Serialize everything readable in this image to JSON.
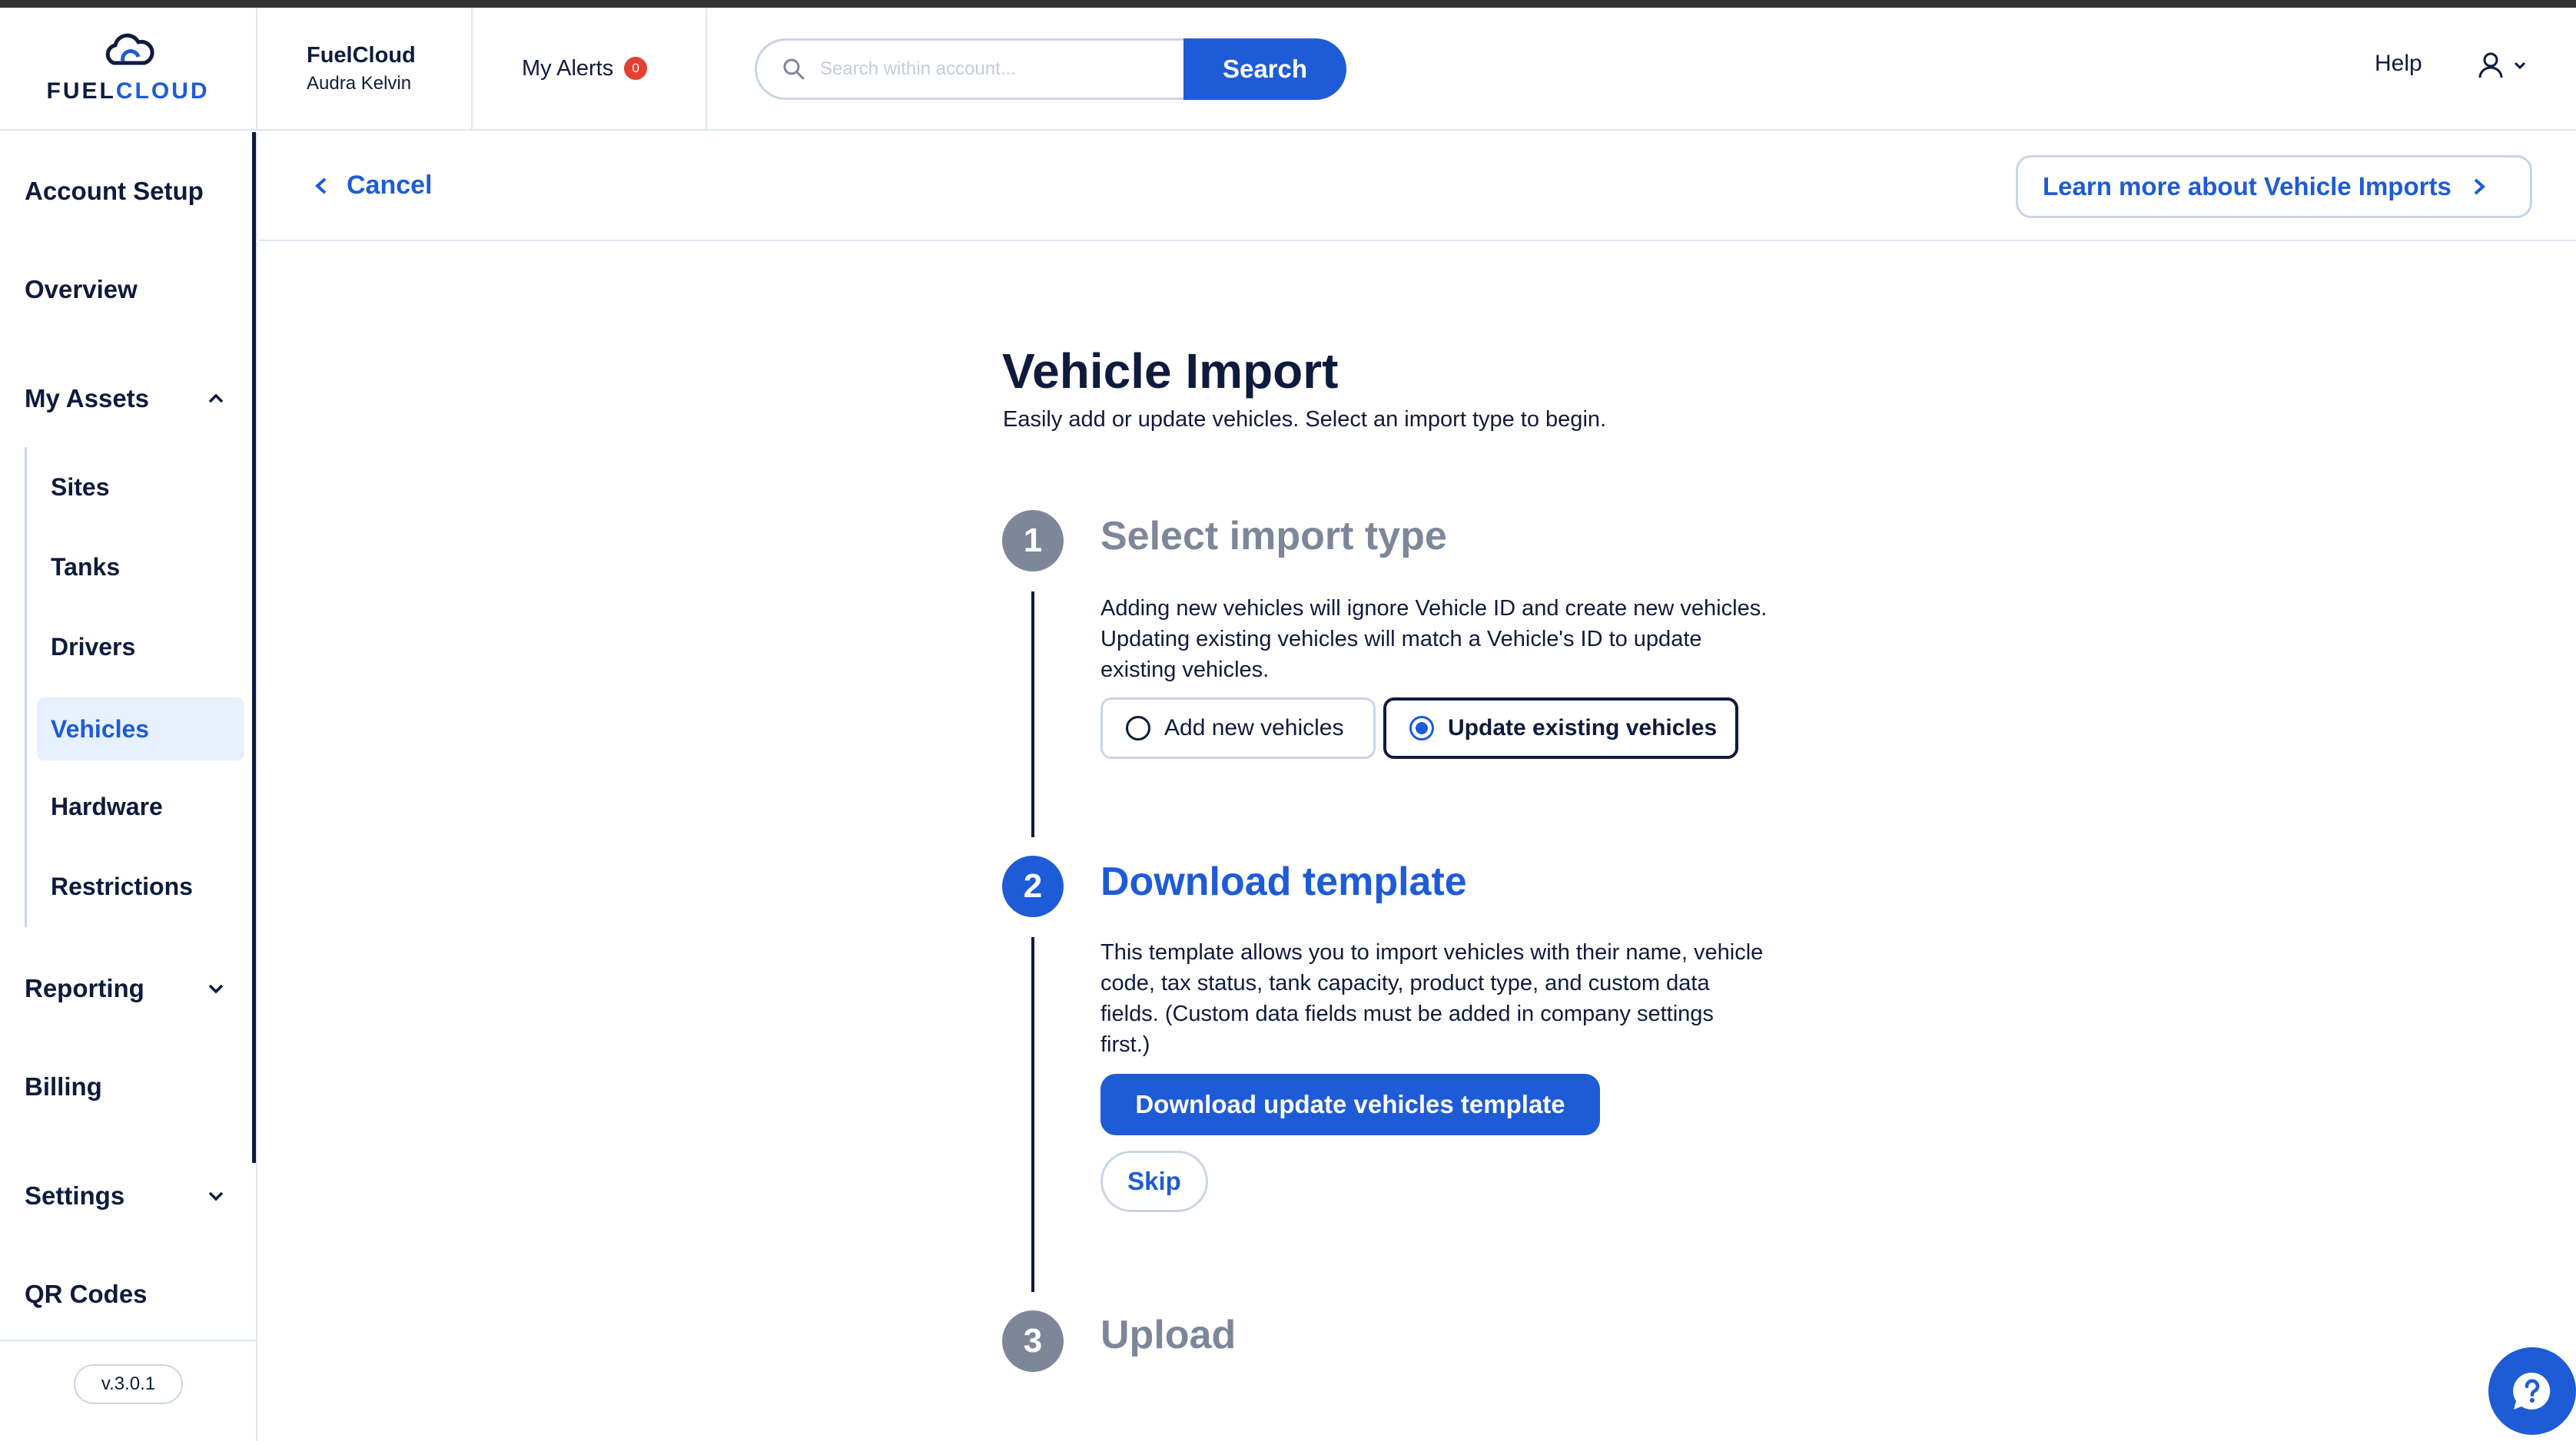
{
  "brand": {
    "name_part1": "FUEL",
    "name_part2": "CLOUD"
  },
  "account": {
    "company": "FuelCloud",
    "user": "Audra Kelvin"
  },
  "alerts": {
    "label": "My Alerts",
    "count": "0"
  },
  "search": {
    "placeholder": "Search within account...",
    "button": "Search"
  },
  "header": {
    "help": "Help"
  },
  "sidebar": {
    "items": [
      {
        "label": "Account Setup"
      },
      {
        "label": "Overview"
      },
      {
        "label": "My Assets"
      },
      {
        "label": "Reporting"
      },
      {
        "label": "Billing"
      },
      {
        "label": "Settings"
      },
      {
        "label": "QR Codes"
      }
    ],
    "assets_sub": [
      {
        "label": "Sites"
      },
      {
        "label": "Tanks"
      },
      {
        "label": "Drivers"
      },
      {
        "label": "Vehicles",
        "active": true
      },
      {
        "label": "Hardware"
      },
      {
        "label": "Restrictions"
      }
    ],
    "version": "v.3.0.1"
  },
  "subheader": {
    "cancel": "Cancel",
    "learn_more": "Learn more about Vehicle Imports"
  },
  "page": {
    "title": "Vehicle Import",
    "subtitle": "Easily add or update vehicles. Select an import type to begin."
  },
  "steps": [
    {
      "number": "1",
      "title": "Select import type",
      "desc_lines": [
        "Adding new vehicles will ignore Vehicle ID and create new vehicles.",
        "Updating existing vehicles will match a Vehicle's ID to update",
        "existing vehicles."
      ],
      "options": [
        {
          "label": "Add new vehicles",
          "selected": false
        },
        {
          "label": "Update existing vehicles",
          "selected": true
        }
      ]
    },
    {
      "number": "2",
      "title": "Download template",
      "desc_lines": [
        "This template allows you to import vehicles with their name, vehicle",
        "code, tax status, tank capacity, product type, and custom data",
        "fields. (Custom data fields must be added in company settings",
        "first.)"
      ],
      "primary_button": "Download update vehicles template",
      "skip_button": "Skip"
    },
    {
      "number": "3",
      "title": "Upload"
    }
  ],
  "colors": {
    "primary": "#1e5bd6",
    "navy": "#0f1b3d",
    "muted": "#7d8799",
    "alert": "#e4402f"
  }
}
